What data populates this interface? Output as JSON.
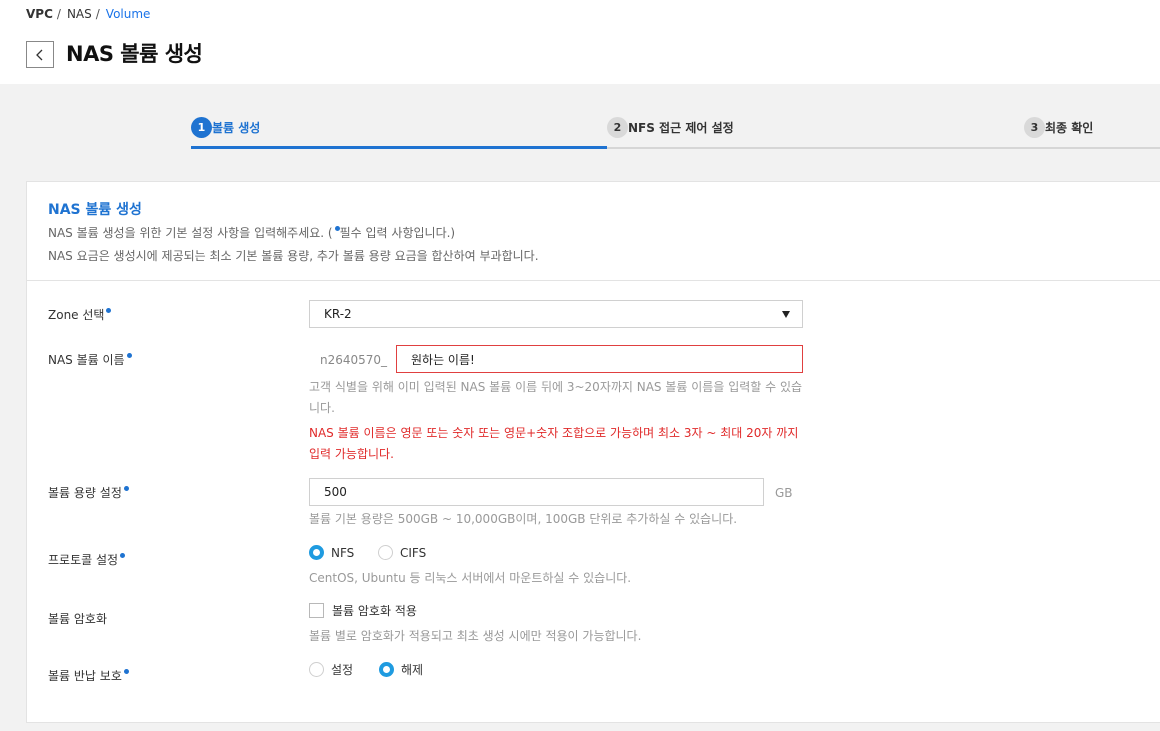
{
  "breadcrumb": {
    "vpc": "VPC",
    "sep1": "/",
    "nas": "NAS",
    "sep2": "/",
    "current": "Volume"
  },
  "header": {
    "title": "NAS 볼륨 생성",
    "back_icon": "chevron-left-icon"
  },
  "steps": [
    {
      "num": "1",
      "label": "볼륨 생성",
      "active": true
    },
    {
      "num": "2",
      "label": "NFS 접근 제어 설정",
      "active": false
    },
    {
      "num": "3",
      "label": "최종 확인",
      "active": false
    }
  ],
  "card": {
    "title": "NAS 볼륨 생성",
    "desc1_before": "NAS 볼륨 생성을 위한 기본 설정 사항을 입력해주세요. (",
    "desc1_after": "필수 입력 사항입니다.)",
    "desc2": "NAS 요금은 생성시에 제공되는 최소 기본 볼륨 용량, 추가 볼륨 용량 요금을 합산하여 부과합니다."
  },
  "form": {
    "zone": {
      "label": "Zone 선택",
      "value": "KR-2"
    },
    "name": {
      "label": "NAS 볼륨 이름",
      "prefix": "n2640570_",
      "value": "원하는 이름!",
      "help": "고객 식별을 위해 이미 입력된 NAS 볼륨 이름 뒤에 3~20자까지 NAS 볼륨 이름을 입력할 수 있습니다.",
      "error": "NAS 볼륨 이름은 영문 또는 숫자 또는 영문+숫자 조합으로 가능하며 최소 3자 ~ 최대 20자 까지 입력 가능합니다."
    },
    "capacity": {
      "label": "볼륨 용량 설정",
      "value": "500",
      "unit": "GB",
      "help": "볼륨 기본 용량은 500GB ~ 10,000GB이며, 100GB 단위로 추가하실 수 있습니다."
    },
    "protocol": {
      "label": "프로토콜 설정",
      "options": [
        "NFS",
        "CIFS"
      ],
      "selected": "NFS",
      "help": "CentOS, Ubuntu 등 리눅스 서버에서 마운트하실 수 있습니다."
    },
    "encryption": {
      "label": "볼륨 암호화",
      "checkbox_label": "볼륨 암호화 적용",
      "checked": false,
      "help": "볼륨 별로 암호화가 적용되고 최초 생성 시에만 적용이 가능합니다."
    },
    "return_protection": {
      "label": "볼륨 반납 보호",
      "options": [
        "설정",
        "해제"
      ],
      "selected": "해제"
    }
  },
  "colors": {
    "accent": "#1f73d1",
    "radio_on": "#1f9be0",
    "error": "#e02a2a",
    "background": "#f2f2f2"
  }
}
